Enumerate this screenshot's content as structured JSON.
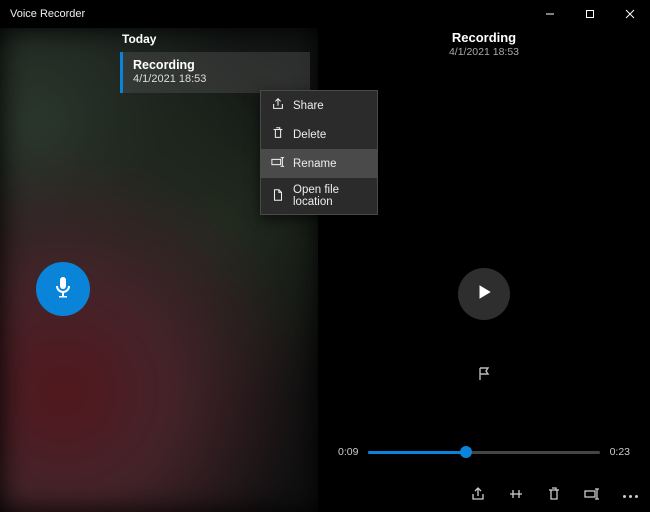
{
  "app": {
    "title": "Voice Recorder"
  },
  "list": {
    "section": "Today",
    "items": [
      {
        "title": "Recording",
        "date": "4/1/2021 18:53"
      }
    ]
  },
  "contextMenu": {
    "share": "Share",
    "delete": "Delete",
    "rename": "Rename",
    "openLocation": "Open file location"
  },
  "detail": {
    "title": "Recording",
    "date": "4/1/2021 18:53"
  },
  "timeline": {
    "current": "0:09",
    "total": "0:23"
  }
}
